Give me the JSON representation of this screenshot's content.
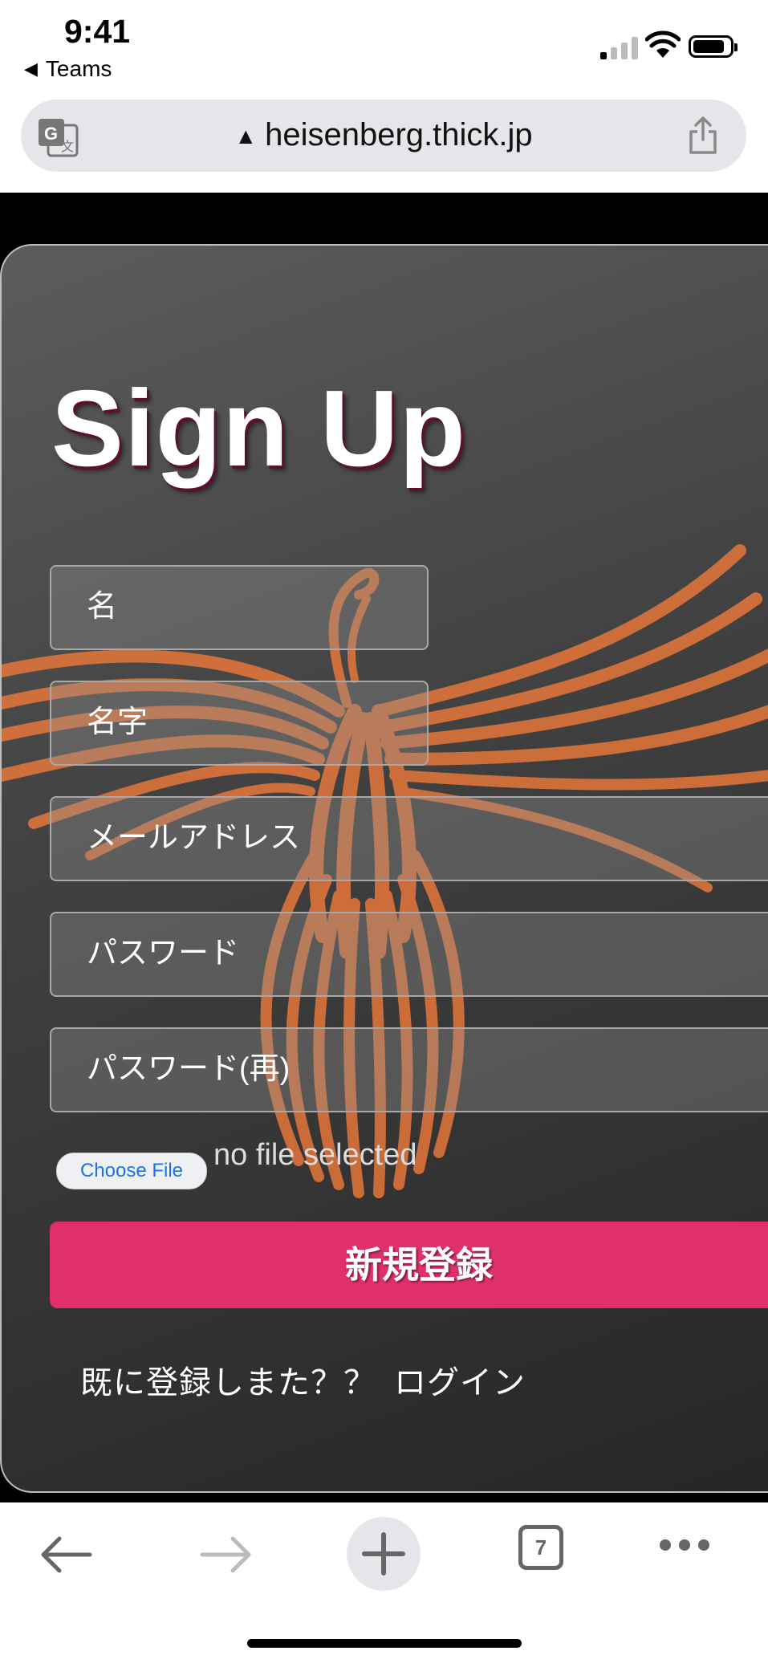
{
  "status_bar": {
    "time": "9:41",
    "back_app_label": "Teams",
    "signal_bars_on": 1,
    "signal_bars_total": 4
  },
  "browser": {
    "url": "heisenberg.thick.jp",
    "open_tabs_count": "7"
  },
  "form": {
    "title": "Sign Up",
    "first_name_placeholder": "名",
    "last_name_placeholder": "名字",
    "email_placeholder": "メールアドレス",
    "password_placeholder": "パスワード",
    "password_confirm_placeholder": "パスワード(再)",
    "choose_file_label": "Choose File",
    "no_file_text": "no file selected",
    "submit_label": "新規登録",
    "already_registered_text": "既に登録しまた？？",
    "login_link": "ログイン"
  },
  "colors": {
    "accent": "#e0306a",
    "card_bg": "#3f3f3f",
    "phoenix": "#f07a3a"
  }
}
